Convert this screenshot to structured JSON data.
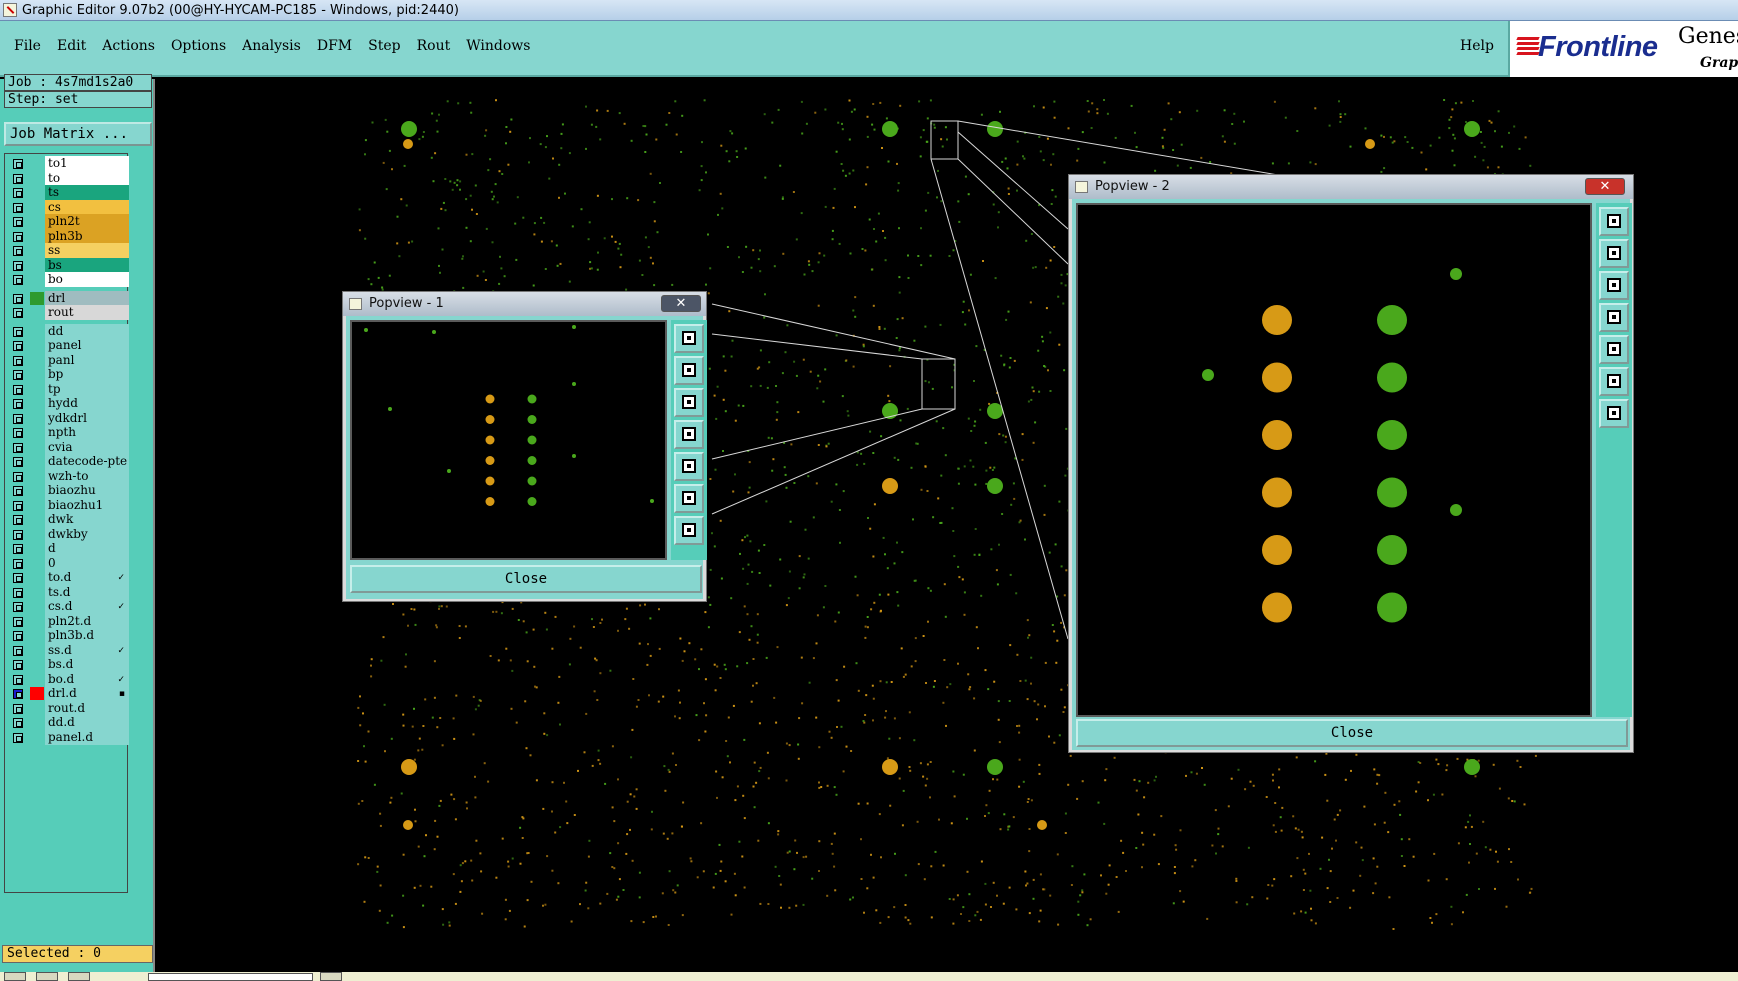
{
  "window": {
    "title": "Graphic Editor 9.07b2 (00@HY-HYCAM-PC185 - Windows, pid:2440)"
  },
  "menu": {
    "items": [
      "File",
      "Edit",
      "Actions",
      "Options",
      "Analysis",
      "DFM",
      "Step",
      "Rout",
      "Windows"
    ],
    "help": "Help"
  },
  "logo": {
    "brand": "Frontline",
    "product": "Genes",
    "sub": "Graph"
  },
  "panel": {
    "job": "Job : 4s7md1s2a0",
    "step": "Step: set",
    "job_matrix": "Job Matrix ...",
    "selected": "Selected : 0"
  },
  "layers": [
    {
      "name": "to1",
      "color": "#ffffff",
      "swatch": ""
    },
    {
      "name": "to",
      "color": "#ffffff",
      "swatch": ""
    },
    {
      "name": "ts",
      "color": "#1aa57e",
      "swatch": ""
    },
    {
      "name": "cs",
      "color": "#f2c040",
      "swatch": ""
    },
    {
      "name": "pln2t",
      "color": "#dba223",
      "swatch": ""
    },
    {
      "name": "pln3b",
      "color": "#dba223",
      "swatch": ""
    },
    {
      "name": "ss",
      "color": "#f5d061",
      "swatch": ""
    },
    {
      "name": "bs",
      "color": "#1aa57e",
      "swatch": ""
    },
    {
      "name": "bo",
      "color": "#ffffff",
      "swatch": ""
    },
    {
      "name": "drl",
      "color": "#9fbcc0",
      "swatch": "#2e9a2e",
      "gap": true
    },
    {
      "name": "rout",
      "color": "#d8d8d8",
      "swatch": ""
    },
    {
      "name": "dd",
      "color": "#86d6cf",
      "swatch": "",
      "gap": true
    },
    {
      "name": "panel",
      "color": "#86d6cf",
      "swatch": ""
    },
    {
      "name": "panl",
      "color": "#86d6cf",
      "swatch": ""
    },
    {
      "name": "bp",
      "color": "#86d6cf",
      "swatch": ""
    },
    {
      "name": "tp",
      "color": "#86d6cf",
      "swatch": ""
    },
    {
      "name": "hydd",
      "color": "#86d6cf",
      "swatch": ""
    },
    {
      "name": "ydkdrl",
      "color": "#86d6cf",
      "swatch": ""
    },
    {
      "name": "npth",
      "color": "#86d6cf",
      "swatch": ""
    },
    {
      "name": "cvia",
      "color": "#86d6cf",
      "swatch": ""
    },
    {
      "name": "datecode-pte",
      "color": "#86d6cf",
      "swatch": ""
    },
    {
      "name": "wzh-to",
      "color": "#86d6cf",
      "swatch": ""
    },
    {
      "name": "biaozhu",
      "color": "#86d6cf",
      "swatch": ""
    },
    {
      "name": "biaozhu1",
      "color": "#86d6cf",
      "swatch": ""
    },
    {
      "name": "dwk",
      "color": "#86d6cf",
      "swatch": ""
    },
    {
      "name": "dwkby",
      "color": "#86d6cf",
      "swatch": ""
    },
    {
      "name": "d",
      "color": "#86d6cf",
      "swatch": ""
    },
    {
      "name": "0",
      "color": "#86d6cf",
      "swatch": ""
    },
    {
      "name": "to.d",
      "color": "#86d6cf",
      "swatch": "",
      "mark": "✓"
    },
    {
      "name": "ts.d",
      "color": "#86d6cf",
      "swatch": ""
    },
    {
      "name": "cs.d",
      "color": "#86d6cf",
      "swatch": "",
      "mark": "✓"
    },
    {
      "name": "pln2t.d",
      "color": "#86d6cf",
      "swatch": ""
    },
    {
      "name": "pln3b.d",
      "color": "#86d6cf",
      "swatch": ""
    },
    {
      "name": "ss.d",
      "color": "#86d6cf",
      "swatch": "",
      "mark": "✓"
    },
    {
      "name": "bs.d",
      "color": "#86d6cf",
      "swatch": ""
    },
    {
      "name": "bo.d",
      "color": "#86d6cf",
      "swatch": "",
      "mark": "✓"
    },
    {
      "name": "drl.d",
      "color": "#86d6cf",
      "swatch": "#ff0000",
      "active": true,
      "mark": "▪"
    },
    {
      "name": "rout.d",
      "color": "#86d6cf",
      "swatch": ""
    },
    {
      "name": "dd.d",
      "color": "#86d6cf",
      "swatch": ""
    },
    {
      "name": "panel.d",
      "color": "#86d6cf",
      "swatch": ""
    }
  ],
  "popview1": {
    "title": "Popview - 1",
    "close_label": "Close"
  },
  "popview2": {
    "title": "Popview - 2",
    "close_label": "Close"
  },
  "colors": {
    "pad_orange": "#d79a16",
    "pad_green": "#4aa81c",
    "menu_bg": "#86d6cf",
    "panel_bg": "#56cdb9"
  },
  "popview_tools": [
    "zoom-window-icon",
    "pan-up-icon",
    "pan-down-icon",
    "pan-left-icon",
    "pan-right-icon",
    "zoom-fit-icon",
    "zoom-home-icon"
  ]
}
